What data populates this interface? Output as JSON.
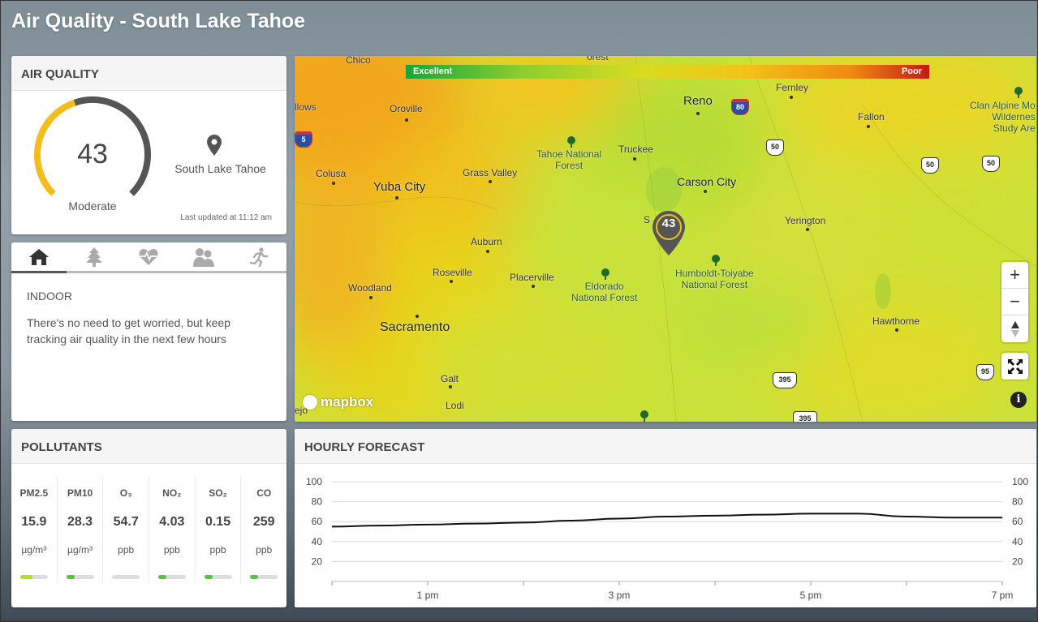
{
  "app": {
    "title": "Air Quality - South Lake Tahoe"
  },
  "air_quality": {
    "header": "AIR QUALITY",
    "aqi": "43",
    "aqi_value": 43,
    "aqi_max": 100,
    "category": "Moderate",
    "location": "South Lake Tahoe",
    "last_updated": "Last updated at 11:12 am",
    "gauge_color": "#f2bd1d",
    "gauge_track_color": "#555555"
  },
  "advice": {
    "tabs": [
      {
        "name": "home-icon",
        "active": true
      },
      {
        "name": "tree-icon",
        "active": false
      },
      {
        "name": "heart-pulse-icon",
        "active": false
      },
      {
        "name": "people-icon",
        "active": false
      },
      {
        "name": "runner-icon",
        "active": false
      }
    ],
    "title": "INDOOR",
    "text": "There's no need to get worried, but keep tracking air quality in the next few hours"
  },
  "map": {
    "scale_low": "Excellent",
    "scale_high": "Poor",
    "marker_aqi": "43",
    "attribution": "mapbox",
    "zoom_in": "+",
    "zoom_out": "−",
    "info": "i",
    "places": {
      "chico": "Chico",
      "willows": "llows",
      "oroville": "Oroville",
      "colusa": "Colusa",
      "yuba_city": "Yuba City",
      "grass_valley": "Grass Valley",
      "tahoe_nf": "Tahoe National\nForest",
      "truckee": "Truckee",
      "reno": "Reno",
      "fernley": "Fernley",
      "fallon": "Fallon",
      "clan_alpine": "Clan Alpine Mo\nWildernes\nStudy Are",
      "carson_city": "Carson City",
      "south_lake": "S      ke",
      "yerington": "Yerington",
      "auburn": "Auburn",
      "roseville": "Roseville",
      "placerville": "Placerville",
      "eldorado_nf": "Eldorado\nNational Forest",
      "humboldt_nf": "Humboldt-Toiyabe\nNational Forest",
      "woodland": "Woodland",
      "sacramento": "Sacramento",
      "hawthorne": "Hawthorne",
      "galt": "Galt",
      "lodi": "Lodi",
      "forest_top": "orest",
      "ejo": "ejo"
    },
    "shields": {
      "i5": "5",
      "i80": "80",
      "us50a": "50",
      "us50b": "50",
      "us50c": "50",
      "us395a": "395",
      "us395b": "395",
      "us95": "95"
    }
  },
  "pollutants": {
    "header": "POLLUTANTS",
    "items": [
      {
        "name": "PM2.5",
        "value": "15.9",
        "unit": "µg/m³",
        "level": 0.45,
        "color": "#b4dc2c"
      },
      {
        "name": "PM10",
        "value": "28.3",
        "unit": "µg/m³",
        "level": 0.3,
        "color": "#5cbd47"
      },
      {
        "name": "O₃",
        "value": "54.7",
        "unit": "ppb",
        "level": 0.0,
        "color": "#5cbd47"
      },
      {
        "name": "NO₂",
        "value": "4.03",
        "unit": "ppb",
        "level": 0.3,
        "color": "#5cbd47"
      },
      {
        "name": "SO₂",
        "value": "0.15",
        "unit": "ppb",
        "level": 0.3,
        "color": "#5cbd47"
      },
      {
        "name": "CO",
        "value": "259",
        "unit": "ppb",
        "level": 0.3,
        "color": "#5cbd47"
      }
    ]
  },
  "forecast": {
    "header": "HOURLY FORECAST"
  },
  "chart_data": {
    "type": "line",
    "title": "",
    "xlabel": "",
    "ylabel": "",
    "ylim": [
      0,
      100
    ],
    "y_ticks": [
      20,
      40,
      60,
      80,
      100
    ],
    "x_labels": [
      "1 pm",
      "3 pm",
      "5 pm",
      "7 pm"
    ],
    "x": [
      0,
      0.5,
      1,
      1.5,
      2,
      2.5,
      3,
      3.5,
      4,
      4.5,
      5,
      5.5,
      6,
      6.5,
      7
    ],
    "x_start": 0,
    "x_end": 7,
    "x_label_positions": [
      1,
      3,
      5,
      7
    ],
    "x_minor_ticks": [
      0,
      1,
      2,
      3,
      4,
      5,
      6,
      7
    ],
    "series": [
      {
        "values": [
          55,
          56,
          57,
          58,
          59,
          61,
          63,
          65,
          66,
          67,
          68,
          68,
          65,
          64,
          64
        ]
      }
    ],
    "grid": true,
    "line_color": "#111111"
  }
}
